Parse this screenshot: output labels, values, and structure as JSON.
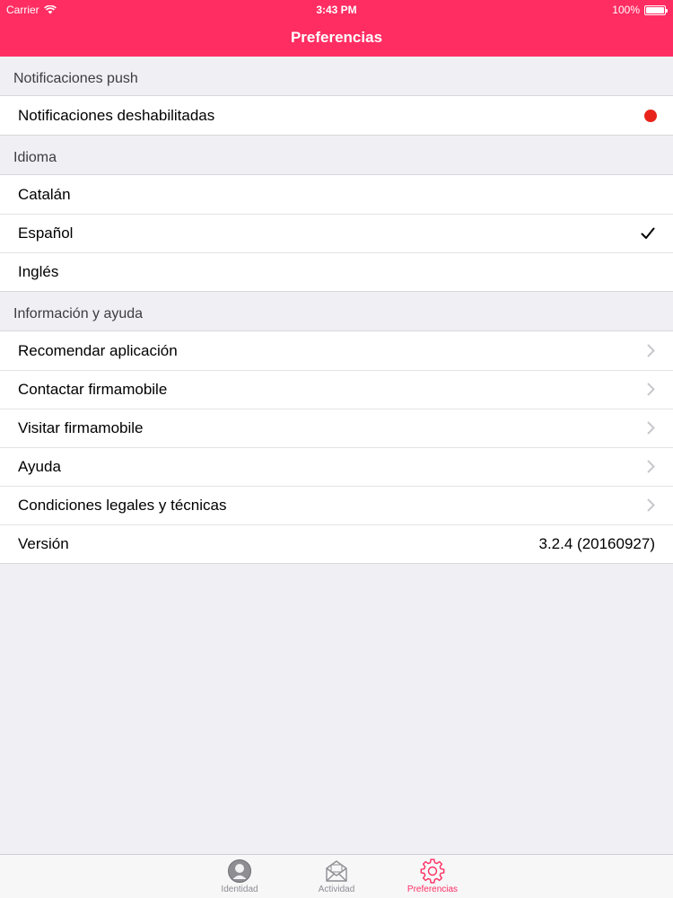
{
  "status_bar": {
    "carrier": "Carrier",
    "time": "3:43 PM",
    "battery": "100%"
  },
  "nav": {
    "title": "Preferencias"
  },
  "sections": {
    "push": {
      "header": "Notificaciones push",
      "rows": [
        {
          "label": "Notificaciones deshabilitadas",
          "indicator": "red-dot",
          "indicator_color": "#e8241a"
        }
      ]
    },
    "language": {
      "header": "Idioma",
      "rows": [
        {
          "label": "Catalán",
          "selected": false
        },
        {
          "label": "Español",
          "selected": true
        },
        {
          "label": "Inglés",
          "selected": false
        }
      ]
    },
    "info": {
      "header": "Información y ayuda",
      "rows": [
        {
          "label": "Recomendar aplicación",
          "accessory": "chevron-right-icon"
        },
        {
          "label": "Contactar firmamobile",
          "accessory": "chevron-right-icon"
        },
        {
          "label": "Visitar firmamobile",
          "accessory": "chevron-right-icon"
        },
        {
          "label": "Ayuda",
          "accessory": "chevron-right-icon"
        },
        {
          "label": "Condiciones legales y técnicas",
          "accessory": "chevron-right-icon"
        },
        {
          "label": "Versión",
          "value": "3.2.4 (20160927)"
        }
      ]
    }
  },
  "tabbar": {
    "tabs": [
      {
        "label": "Identidad",
        "icon": "person-icon",
        "active": false
      },
      {
        "label": "Actividad",
        "icon": "envelope-icon",
        "active": false
      },
      {
        "label": "Preferencias",
        "icon": "gear-icon",
        "active": true
      }
    ]
  },
  "colors": {
    "accent": "#ff2d62",
    "background": "#efeff4",
    "inactive_tab": "#8e8e93"
  }
}
